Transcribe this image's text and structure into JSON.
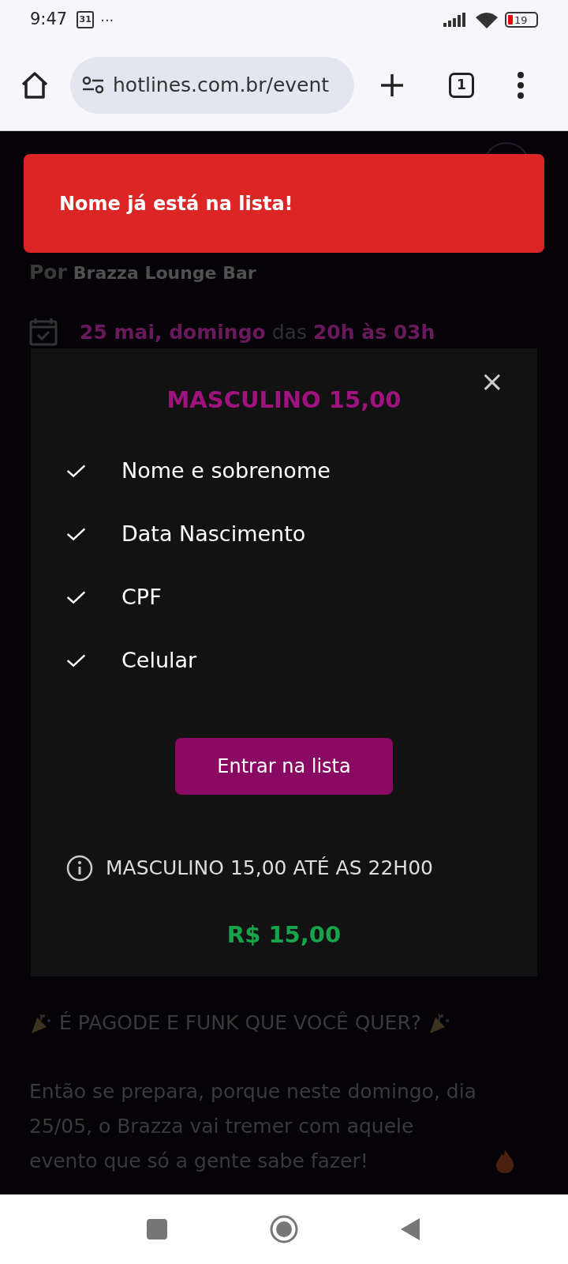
{
  "status_bar": {
    "time": "9:47",
    "calendar_badge": "31",
    "more": "···",
    "battery": "19"
  },
  "browser": {
    "url": "hotlines.com.br/event",
    "tab_count": "1"
  },
  "toast": {
    "message": "Nome já está na lista!"
  },
  "event": {
    "by_label": "Por",
    "organizer": "Brazza Lounge Bar",
    "date": "25 mai, domingo",
    "between": "das",
    "hours": "20h às 03h"
  },
  "modal": {
    "title": "MASCULINO 15,00",
    "close": "×",
    "fields": [
      {
        "label": "Nome e sobrenome",
        "checked": true
      },
      {
        "label": "Data Nascimento",
        "checked": true
      },
      {
        "label": "CPF",
        "checked": true
      },
      {
        "label": "Celular",
        "checked": true
      }
    ],
    "button": "Entrar na lista",
    "info": "MASCULINO 15,00 ATÉ AS 22H00",
    "price": "R$ 15,00"
  },
  "description": {
    "heading": "É PAGODE E FUNK QUE VOCÊ QUER?",
    "paragraph": "Então se prepara, porque neste domingo, dia 25/05, o Brazza vai tremer com aquele evento que só a gente sabe fazer!"
  }
}
